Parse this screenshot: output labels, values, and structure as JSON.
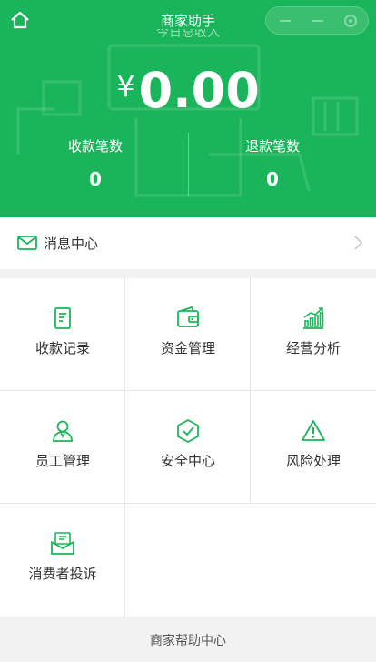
{
  "header": {
    "title": "商家助手",
    "home_icon": "home-icon",
    "capsule_icons": [
      "back-icon",
      "more-icon",
      "settings-icon"
    ]
  },
  "summary": {
    "income_label": "今日总收入",
    "currency": "¥",
    "amount": "0.00",
    "receipts_label": "收款笔数",
    "receipts_value": "0",
    "refunds_label": "退款笔数",
    "refunds_value": "0"
  },
  "message_center": {
    "label": "消息中心",
    "icon": "envelope-icon"
  },
  "menu": [
    {
      "label": "收款记录",
      "icon": "receipt-icon"
    },
    {
      "label": "资金管理",
      "icon": "wallet-icon"
    },
    {
      "label": "经营分析",
      "icon": "chart-icon"
    },
    {
      "label": "员工管理",
      "icon": "staff-icon"
    },
    {
      "label": "安全中心",
      "icon": "shield-icon"
    },
    {
      "label": "风险处理",
      "icon": "warning-icon"
    },
    {
      "label": "消费者投诉",
      "icon": "complaint-icon"
    }
  ],
  "footer": {
    "help_label": "商家帮助中心"
  },
  "colors": {
    "brand_green": "#1ab55a",
    "icon_green": "#1ab55a",
    "text": "#333333"
  }
}
